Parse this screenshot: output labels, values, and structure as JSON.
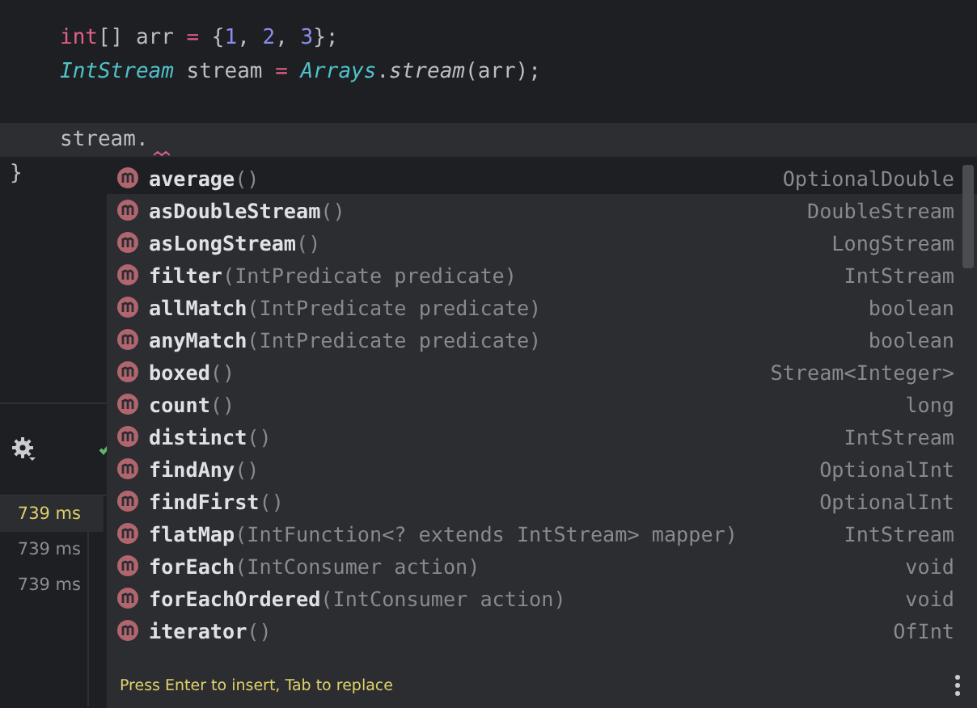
{
  "editor": {
    "lines": [
      {
        "kind": "body",
        "current": false,
        "tokens": [
          {
            "kind": "keyword",
            "text": "int"
          },
          {
            "kind": "plain",
            "text": "[] arr "
          },
          {
            "kind": "operator",
            "text": "="
          },
          {
            "kind": "plain",
            "text": " {"
          },
          {
            "kind": "number",
            "text": "1"
          },
          {
            "kind": "plain",
            "text": ", "
          },
          {
            "kind": "number",
            "text": "2"
          },
          {
            "kind": "plain",
            "text": ", "
          },
          {
            "kind": "number",
            "text": "3"
          },
          {
            "kind": "plain",
            "text": "};"
          }
        ]
      },
      {
        "kind": "body",
        "current": false,
        "tokens": [
          {
            "kind": "type",
            "text": "IntStream"
          },
          {
            "kind": "plain",
            "text": " stream "
          },
          {
            "kind": "operator",
            "text": "= "
          },
          {
            "kind": "type",
            "text": "Arrays"
          },
          {
            "kind": "plain",
            "text": "."
          },
          {
            "kind": "static",
            "text": "stream"
          },
          {
            "kind": "plain",
            "text": "(arr);"
          }
        ]
      },
      {
        "kind": "body",
        "current": false
      },
      {
        "kind": "body",
        "current": true,
        "error": true,
        "tokens": [
          {
            "kind": "plain",
            "text": "stream."
          }
        ]
      },
      {
        "kind": "closing",
        "current": false,
        "tokens": [
          {
            "kind": "plain",
            "text": "}"
          }
        ]
      }
    ]
  },
  "run_panel": {
    "rows": [
      {
        "time": "739 ms",
        "selected": true
      },
      {
        "time": "739 ms",
        "selected": false
      },
      {
        "time": "739 ms",
        "selected": false
      }
    ]
  },
  "completion": {
    "items": [
      {
        "name": "average",
        "params": "()",
        "type": "OptionalDouble",
        "selected": true
      },
      {
        "name": "asDoubleStream",
        "params": "()",
        "type": "DoubleStream",
        "selected": false
      },
      {
        "name": "asLongStream",
        "params": "()",
        "type": "LongStream",
        "selected": false
      },
      {
        "name": "filter",
        "params": "(IntPredicate predicate)",
        "type": "IntStream",
        "selected": false
      },
      {
        "name": "allMatch",
        "params": "(IntPredicate predicate)",
        "type": "boolean",
        "selected": false
      },
      {
        "name": "anyMatch",
        "params": "(IntPredicate predicate)",
        "type": "boolean",
        "selected": false
      },
      {
        "name": "boxed",
        "params": "()",
        "type": "Stream<Integer>",
        "selected": false
      },
      {
        "name": "count",
        "params": "()",
        "type": "long",
        "selected": false
      },
      {
        "name": "distinct",
        "params": "()",
        "type": "IntStream",
        "selected": false
      },
      {
        "name": "findAny",
        "params": "()",
        "type": "OptionalInt",
        "selected": false
      },
      {
        "name": "findFirst",
        "params": "()",
        "type": "OptionalInt",
        "selected": false
      },
      {
        "name": "flatMap",
        "params": "(IntFunction<? extends IntStream> mapper)",
        "type": "IntStream",
        "selected": false
      },
      {
        "name": "forEach",
        "params": "(IntConsumer action)",
        "type": "void",
        "selected": false
      },
      {
        "name": "forEachOrdered",
        "params": "(IntConsumer action)",
        "type": "void",
        "selected": false
      },
      {
        "name": "iterator",
        "params": "()",
        "type": "OfInt",
        "selected": false
      }
    ],
    "footer": "Press Enter to insert, Tab to replace"
  }
}
